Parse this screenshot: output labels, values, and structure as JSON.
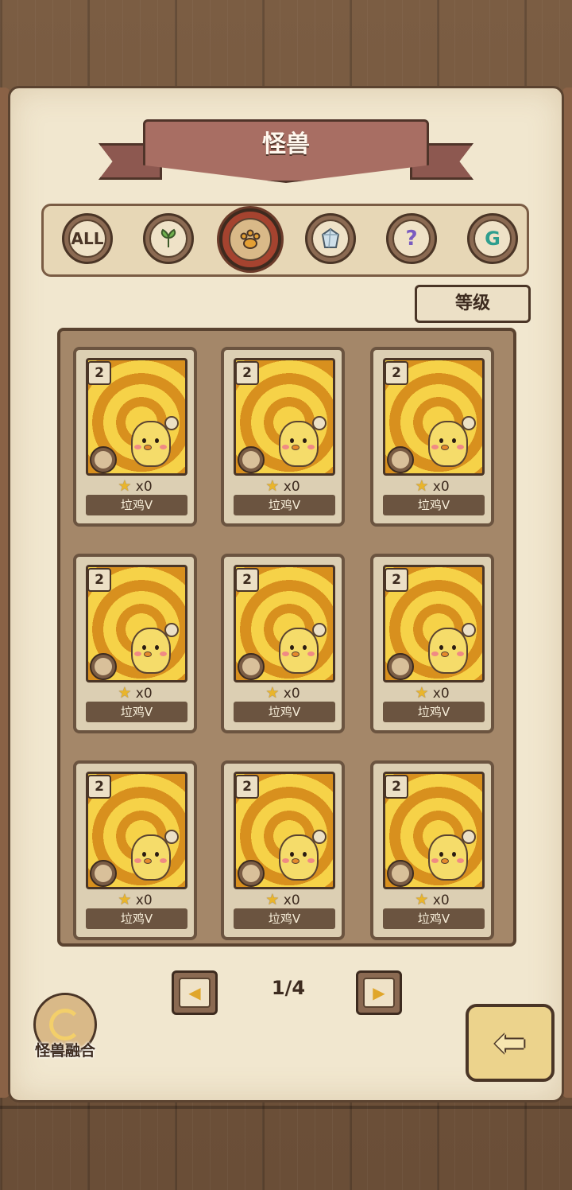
{
  "header": {
    "title": "怪兽"
  },
  "filters": [
    {
      "id": "all",
      "label": "ALL",
      "icon": "all-icon",
      "active": false
    },
    {
      "id": "plant",
      "label": "",
      "icon": "leaf-icon",
      "active": false
    },
    {
      "id": "beast",
      "label": "",
      "icon": "paw-icon",
      "active": true
    },
    {
      "id": "crystal",
      "label": "",
      "icon": "crystal-icon",
      "active": false
    },
    {
      "id": "mystery",
      "label": "",
      "icon": "question-icon",
      "active": false
    },
    {
      "id": "special",
      "label": "",
      "icon": "g-rune-icon",
      "active": false
    }
  ],
  "sort": {
    "label": "等级"
  },
  "cards": [
    {
      "level": "2",
      "count": "x0",
      "name": "垃鸡V"
    },
    {
      "level": "2",
      "count": "x0",
      "name": "垃鸡V"
    },
    {
      "level": "2",
      "count": "x0",
      "name": "垃鸡V"
    },
    {
      "level": "2",
      "count": "x0",
      "name": "垃鸡V"
    },
    {
      "level": "2",
      "count": "x0",
      "name": "垃鸡V"
    },
    {
      "level": "2",
      "count": "x0",
      "name": "垃鸡V"
    },
    {
      "level": "2",
      "count": "x0",
      "name": "垃鸡V"
    },
    {
      "level": "2",
      "count": "x0",
      "name": "垃鸡V"
    },
    {
      "level": "2",
      "count": "x0",
      "name": "垃鸡V"
    }
  ],
  "pagination": {
    "current": "1/4",
    "prev_icon": "triangle-left-icon",
    "next_icon": "triangle-right-icon"
  },
  "fusion": {
    "label": "怪兽融合",
    "icon": "fusion-swirl-icon"
  },
  "back": {
    "icon": "back-arrow-icon"
  },
  "colors": {
    "banner": "#a86e63",
    "paper": "#f1e7cf",
    "active_ring": "#a5432f",
    "card_art": "#f6d248"
  }
}
